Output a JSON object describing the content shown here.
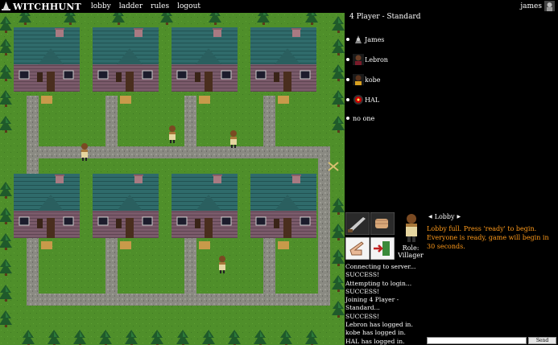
{
  "app": {
    "title": "WITCHHUNT",
    "nav": [
      "lobby",
      "ladder",
      "rules",
      "logout"
    ],
    "username": "james"
  },
  "game": {
    "title": "4 Player - Standard",
    "players": [
      {
        "name": "James",
        "avatar": "wizard-avatar-icon"
      },
      {
        "name": "Lebron",
        "avatar": "lebron-avatar-icon"
      },
      {
        "name": "kobe",
        "avatar": "kobe-avatar-icon"
      },
      {
        "name": "HAL",
        "avatar": "hal-eye-icon"
      },
      {
        "name": "no one",
        "avatar": ""
      }
    ]
  },
  "role": {
    "label": "Role:",
    "value": "Villager"
  },
  "actions": [
    "knife-icon",
    "punch-icon",
    "hand-pointing-icon",
    "exit-door-icon"
  ],
  "log": [
    "Connecting to server...",
    "SUCCESS!",
    "Attempting to login...",
    "SUCCESS!",
    "Joining 4 Player -",
    "Standard...",
    "SUCCESS!",
    "Lebron has logged in.",
    "kobe has logged in.",
    "HAL has logged in."
  ],
  "lobby": {
    "title": "Lobby",
    "messages": [
      "Lobby full. Press 'ready' to begin.",
      "Everyone is ready, game will begin in 30 seconds."
    ],
    "input_value": "",
    "send_label": "Send"
  },
  "colors": {
    "grass": "#4f8f2a",
    "road": "#8a8a82",
    "roof": "#2f6b6b",
    "wall": "#7a5a6a",
    "lobby_text": "#ff9a1a"
  }
}
